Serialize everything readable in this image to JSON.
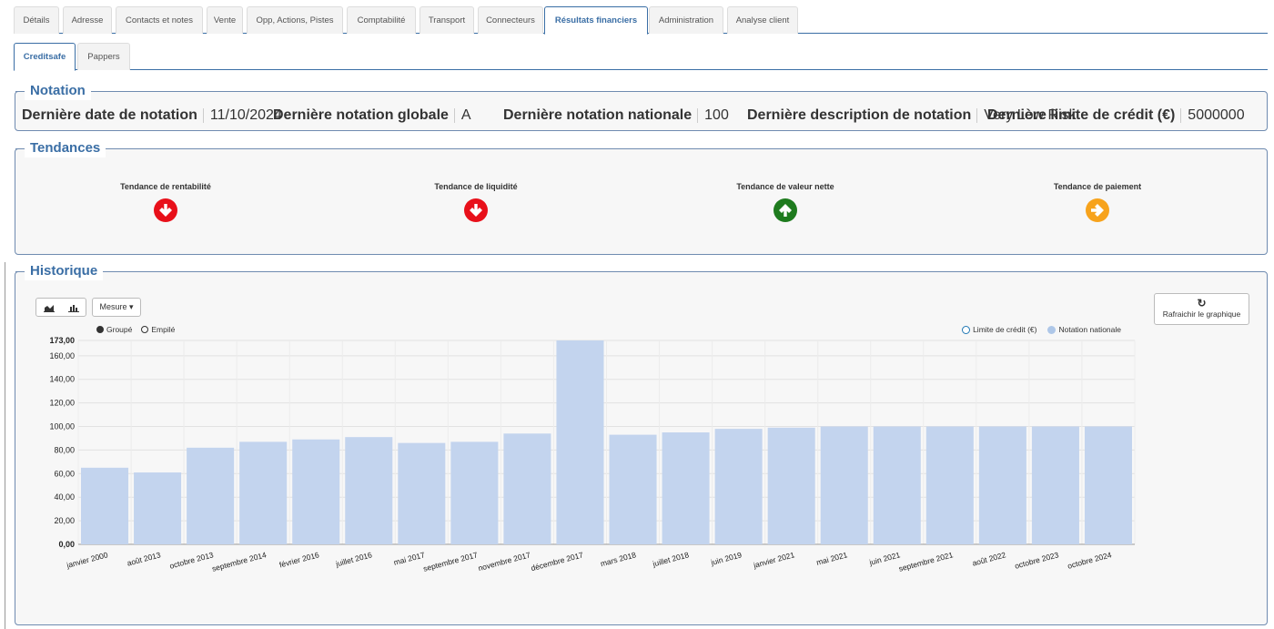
{
  "tabs_main": [
    {
      "label": "Détails",
      "active": false
    },
    {
      "label": "Adresse",
      "active": false
    },
    {
      "label": "Contacts et notes",
      "active": false
    },
    {
      "label": "Vente",
      "active": false
    },
    {
      "label": "Opp, Actions, Pistes",
      "active": false
    },
    {
      "label": "Comptabilité",
      "active": false
    },
    {
      "label": "Transport",
      "active": false
    },
    {
      "label": "Connecteurs",
      "active": false
    },
    {
      "label": "Résultats financiers",
      "active": true
    },
    {
      "label": "Administration",
      "active": false
    },
    {
      "label": "Analyse client",
      "active": false
    }
  ],
  "tabs_sub": [
    {
      "label": "Creditsafe",
      "active": true
    },
    {
      "label": "Pappers",
      "active": false
    }
  ],
  "notation": {
    "legend": "Notation",
    "fields": [
      {
        "label": "Dernière date de notation",
        "value": "11/10/2024"
      },
      {
        "label": "Dernière notation globale",
        "value": "A"
      },
      {
        "label": "Dernière notation nationale",
        "value": "100"
      },
      {
        "label": "Dernière description de notation",
        "value": "Very Low Risk"
      },
      {
        "label": "Dernière limite de crédit (€)",
        "value": "5000000"
      }
    ]
  },
  "tendances": {
    "legend": "Tendances",
    "items": [
      {
        "label": "Tendance de rentabilité",
        "direction": "down",
        "color": "#e8101a"
      },
      {
        "label": "Tendance de liquidité",
        "direction": "down",
        "color": "#e8101a"
      },
      {
        "label": "Tendance de valeur nette",
        "direction": "up",
        "color": "#1e7b1e"
      },
      {
        "label": "Tendance de paiement",
        "direction": "right",
        "color": "#f7a31c"
      }
    ]
  },
  "historique": {
    "legend": "Historique",
    "measure_label": "Mesure ▾",
    "refresh_icon": "↻",
    "refresh_label": "Rafraichir le graphique",
    "radio": {
      "grouped": "Groupé",
      "stacked": "Empilé",
      "selected": "grouped"
    },
    "legend_items": [
      {
        "label": "Limite de crédit (€)",
        "color": "#1f77b4",
        "filled": false
      },
      {
        "label": "Notation nationale",
        "color": "#aec7e8",
        "filled": true
      }
    ]
  },
  "chart_data": {
    "type": "bar",
    "categories": [
      "janvier 2000",
      "août 2013",
      "octobre 2013",
      "septembre 2014",
      "février 2016",
      "juillet 2016",
      "mai 2017",
      "septembre 2017",
      "novembre 2017",
      "décembre 2017",
      "mars 2018",
      "juillet 2018",
      "juin 2019",
      "janvier 2021",
      "mai 2021",
      "juin 2021",
      "septembre 2021",
      "août 2022",
      "octobre 2023",
      "octobre 2024"
    ],
    "series": [
      {
        "name": "Notation nationale",
        "color": "#c3d4ee",
        "values": [
          65,
          61,
          82,
          87,
          89,
          91,
          86,
          87,
          94,
          173,
          93,
          95,
          98,
          99,
          100,
          100,
          100,
          100,
          100,
          100
        ]
      }
    ],
    "ylim": [
      0,
      173
    ],
    "yticks": [
      "0,00",
      "20,00",
      "40,00",
      "60,00",
      "80,00",
      "100,00",
      "120,00",
      "140,00",
      "160,00",
      "173,00"
    ],
    "ytick_values": [
      0,
      20,
      40,
      60,
      80,
      100,
      120,
      140,
      160,
      173
    ],
    "grid": true
  }
}
